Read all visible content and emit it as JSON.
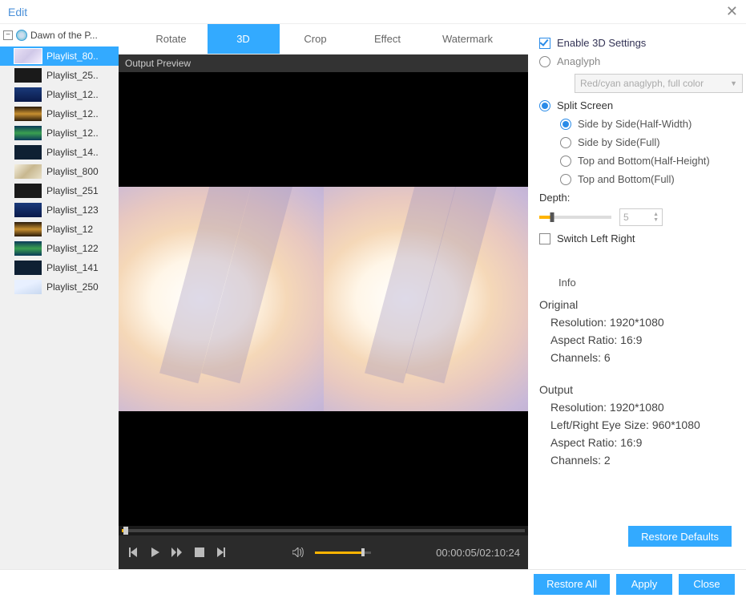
{
  "window_title": "Edit",
  "tree": {
    "root_label": "Dawn of the P..."
  },
  "playlists": [
    {
      "label": "Playlist_80.."
    },
    {
      "label": "Playlist_25.."
    },
    {
      "label": "Playlist_12.."
    },
    {
      "label": "Playlist_12.."
    },
    {
      "label": "Playlist_12.."
    },
    {
      "label": "Playlist_14.."
    },
    {
      "label": "Playlist_800"
    },
    {
      "label": "Playlist_251"
    },
    {
      "label": "Playlist_123"
    },
    {
      "label": "Playlist_12"
    },
    {
      "label": "Playlist_122"
    },
    {
      "label": "Playlist_141"
    },
    {
      "label": "Playlist_250"
    }
  ],
  "tabs": {
    "rotate": "Rotate",
    "three_d": "3D",
    "crop": "Crop",
    "effect": "Effect",
    "watermark": "Watermark"
  },
  "preview_header": "Output Preview",
  "time": {
    "current": "00:00:05",
    "total": "02:10:24"
  },
  "settings": {
    "enable_3d": "Enable 3D Settings",
    "anaglyph": "Anaglyph",
    "anaglyph_select": "Red/cyan anaglyph, full color",
    "split_screen": "Split Screen",
    "sbs_half": "Side by Side(Half-Width)",
    "sbs_full": "Side by Side(Full)",
    "tab_half": "Top and Bottom(Half-Height)",
    "tab_full": "Top and Bottom(Full)",
    "depth_label": "Depth:",
    "depth_value": "5",
    "switch_lr": "Switch Left Right"
  },
  "info": {
    "heading": "Info",
    "original": {
      "title": "Original",
      "resolution": "Resolution: 1920*1080",
      "aspect": "Aspect Ratio: 16:9",
      "channels": "Channels: 6"
    },
    "output": {
      "title": "Output",
      "resolution": "Resolution: 1920*1080",
      "eye_size": "Left/Right Eye Size: 960*1080",
      "aspect": "Aspect Ratio: 16:9",
      "channels": "Channels: 2"
    }
  },
  "buttons": {
    "restore_defaults": "Restore Defaults",
    "restore_all": "Restore All",
    "apply": "Apply",
    "close": "Close"
  }
}
